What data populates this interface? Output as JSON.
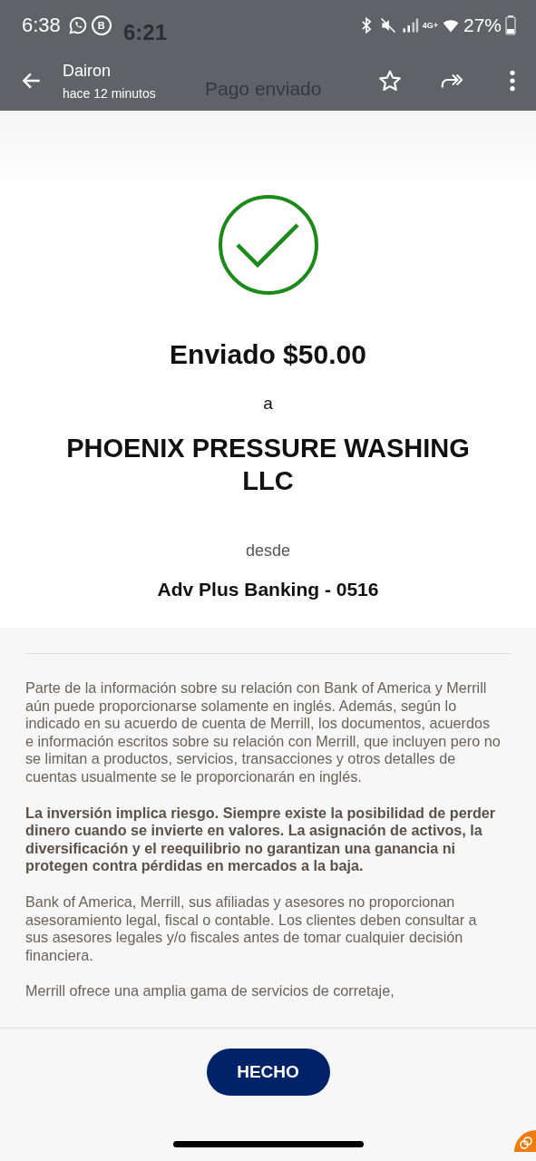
{
  "status_bar": {
    "time": "6:38",
    "notification_letter": "B",
    "network": "4G+",
    "battery": "27%"
  },
  "inner_status_bar": {
    "time": "6:21"
  },
  "viewer_header": {
    "title": "Dairon",
    "subtitle": "hace 12 minutos"
  },
  "inner_header": {
    "title": "Pago enviado"
  },
  "receipt": {
    "amount_line": "Enviado $50.00",
    "connector": "a",
    "payee": "PHOENIX PRESSURE WASHING LLC",
    "from_label": "desde",
    "account": "Adv Plus Banking - 0516"
  },
  "disclosures": [
    {
      "text": "Parte de la información sobre su relación con Bank of America y Merrill aún puede proporcionarse solamente en inglés. Además, según lo indicado en su acuerdo de cuenta de Merrill, los documentos, acuerdos e información escritos sobre su relación con Merrill, que incluyen pero no se limitan a productos, servicios, transacciones y otros detalles de cuentas usualmente se le proporcionarán en inglés.",
      "emphasis": false
    },
    {
      "text": "La inversión implica riesgo. Siempre existe la posibilidad de perder dinero cuando se invierte en valores. La asignación de activos, la diversificación y el reequilibrio no garantizan una ganancia ni protegen contra pérdidas en mercados a la baja.",
      "emphasis": true
    },
    {
      "text": "Bank of America, Merrill, sus afiliadas y asesores no proporcionan asesoramiento legal, fiscal o contable. Los clientes deben consultar a sus asesores legales y/o fiscales antes de tomar cualquier decisión financiera.",
      "emphasis": false
    },
    {
      "text": "Merrill ofrece una amplia gama de servicios de corretaje,",
      "emphasis": false
    }
  ],
  "done_button": {
    "label": "HECHO"
  }
}
